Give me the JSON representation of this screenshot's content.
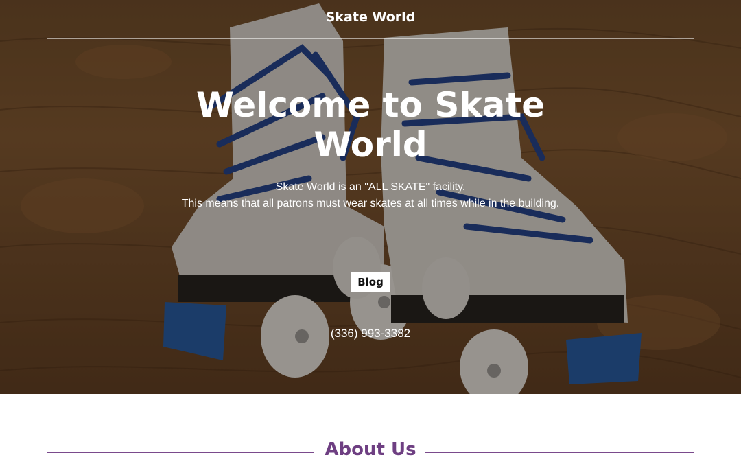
{
  "header": {
    "site_title": "Skate World"
  },
  "hero": {
    "heading": "Welcome to Skate World",
    "description_line1": "Skate World is an \"ALL SKATE\" facility.",
    "description_line2": "This means that all patrons must wear skates at all times while in the building.",
    "button_label": "Blog",
    "phone": "(336) 993-3382"
  },
  "about": {
    "title": "About Us"
  },
  "colors": {
    "accent": "#6e3f82",
    "hero_overlay": "#140c06"
  }
}
